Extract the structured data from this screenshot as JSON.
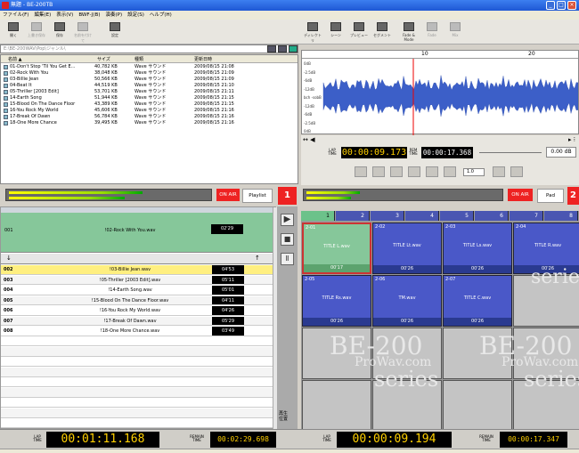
{
  "window": {
    "title": "無題 - BE-200TB"
  },
  "menu": [
    "ファイル(F)",
    "編集(E)",
    "表示(V)",
    "BWF-J(B)",
    "演奏(P)",
    "設定(S)",
    "ヘルプ(H)"
  ],
  "toolbar_left": [
    {
      "label": "開く",
      "icon": "folder-icon"
    },
    {
      "label": "上書き保存",
      "icon": "save-icon"
    },
    {
      "label": "保存",
      "icon": "save-icon"
    },
    {
      "label": "名前を付けて",
      "icon": "save-as-icon"
    },
    {
      "label": "設定",
      "icon": "settings-icon"
    }
  ],
  "toolbar_right": [
    "ディレクトリ",
    "シーン",
    "プレビュー",
    "セグメント",
    "Fade & Mode",
    "Fade",
    "Mix"
  ],
  "path": "E:\\BE-200WAV\\Pop\\ジャンル\\",
  "file_list": {
    "headers": {
      "name": "名前 ▲",
      "size": "サイズ",
      "type": "種類",
      "date": "更新日時"
    },
    "rows": [
      {
        "name": "01-Don't Stop 'Til You Get E...",
        "size": "40,782 KB",
        "type": "Wave サウンド",
        "date": "2009/08/15 21:08"
      },
      {
        "name": "02-Rock With You",
        "size": "38,048 KB",
        "type": "Wave サウンド",
        "date": "2009/08/15 21:09"
      },
      {
        "name": "03-Billie Jean",
        "size": "50,566 KB",
        "type": "Wave サウンド",
        "date": "2009/08/15 21:09"
      },
      {
        "name": "04-Beat It",
        "size": "44,519 KB",
        "type": "Wave サウンド",
        "date": "2009/08/15 21:10"
      },
      {
        "name": "05-Thriller [2003 Edit]",
        "size": "53,701 KB",
        "type": "Wave サウンド",
        "date": "2009/08/15 21:11"
      },
      {
        "name": "14-Earth Song",
        "size": "51,944 KB",
        "type": "Wave サウンド",
        "date": "2009/08/15 21:15"
      },
      {
        "name": "15-Blood On The Dance Floor",
        "size": "43,389 KB",
        "type": "Wave サウンド",
        "date": "2009/08/15 21:15"
      },
      {
        "name": "16-You Rock My World",
        "size": "45,606 KB",
        "type": "Wave サウンド",
        "date": "2009/08/15 21:16"
      },
      {
        "name": "17-Break Of Dawn",
        "size": "56,784 KB",
        "type": "Wave サウンド",
        "date": "2009/08/15 21:16"
      },
      {
        "name": "18-One More Chance",
        "size": "39,495 KB",
        "type": "Wave サウンド",
        "date": "2009/08/15 21:16"
      }
    ]
  },
  "waveform": {
    "timeline": [
      "10",
      "20"
    ],
    "db_labels": [
      "0dB",
      "-2.5dB",
      "-6dB",
      "-12dB",
      "bch -sobB",
      "-12dB",
      "-6dB",
      "-2.5dB",
      "0dB"
    ],
    "lap_label": "LAP\nTIME",
    "lap_time": "00:00:09.173",
    "rem_label": "REM\nTIME",
    "rem_time": "00:00:17.368",
    "speed": "1.0",
    "gain": "0.00",
    "gain_unit": "dB"
  },
  "left_deck": {
    "on_air": "ON AIR",
    "playlist_btn": "Playlist",
    "deck_no": "1",
    "current": {
      "no": "001",
      "name": "!02-Rock With You.wav",
      "duration": "02'29"
    },
    "rows": [
      {
        "no": "002",
        "name": "!03-Billie Jean.wav",
        "duration": "04'53",
        "highlight": true
      },
      {
        "no": "003",
        "name": "!05-Thriller [2003 Edit].wav",
        "duration": "05'11",
        "highlight": false
      },
      {
        "no": "004",
        "name": "!14-Earth Song.wav",
        "duration": "05'01",
        "highlight": false
      },
      {
        "no": "005",
        "name": "!15-Blood On The Dance Floor.wav",
        "duration": "04'11",
        "highlight": false
      },
      {
        "no": "006",
        "name": "!16-You Rock My World.wav",
        "duration": "04'26",
        "highlight": false
      },
      {
        "no": "007",
        "name": "!17-Break Of Dawn.wav",
        "duration": "05'29",
        "highlight": false
      },
      {
        "no": "008",
        "name": "!18-One More Chance.wav",
        "duration": "03'49",
        "highlight": false
      }
    ],
    "vertical_label": "再生\n位置"
  },
  "right_deck": {
    "on_air": "ON AIR",
    "pad_btn": "Pad",
    "deck_no": "2",
    "tabs": [
      "1",
      "2",
      "3",
      "4",
      "5",
      "6",
      "7",
      "8"
    ],
    "cards": [
      {
        "id": "2-01",
        "name": "TITLE L.wav",
        "duration": "00'17"
      },
      {
        "id": "2-02",
        "name": "TITLE Lt.wav",
        "duration": "00'26"
      },
      {
        "id": "2-03",
        "name": "TITLE Ls.wav",
        "duration": "00'26"
      },
      {
        "id": "2-04",
        "name": "TITLE R.wav",
        "duration": "00'26"
      },
      {
        "id": "2-05",
        "name": "TITLE Rs.wav",
        "duration": "00'26"
      },
      {
        "id": "2-06",
        "name": "TM.wav",
        "duration": "00'26"
      },
      {
        "id": "2-07",
        "name": "TITLE C.wav",
        "duration": "00'26"
      }
    ]
  },
  "bottom_left": {
    "lap_label": "LAP\nTIME",
    "lap_time": "00:01:11.168",
    "remain_label": "REMAIN\nTIME",
    "remain_time": "00:02:29.698"
  },
  "bottom_right": {
    "lap_label": "LAP\nTIME",
    "lap_time": "00:00:09.194",
    "remain_label": "REMAIN\nTIME",
    "remain_time": "00:00:17.347"
  },
  "watermark": {
    "line1": "BE-200",
    "line2": "ProWav.com",
    "line3": "series"
  }
}
